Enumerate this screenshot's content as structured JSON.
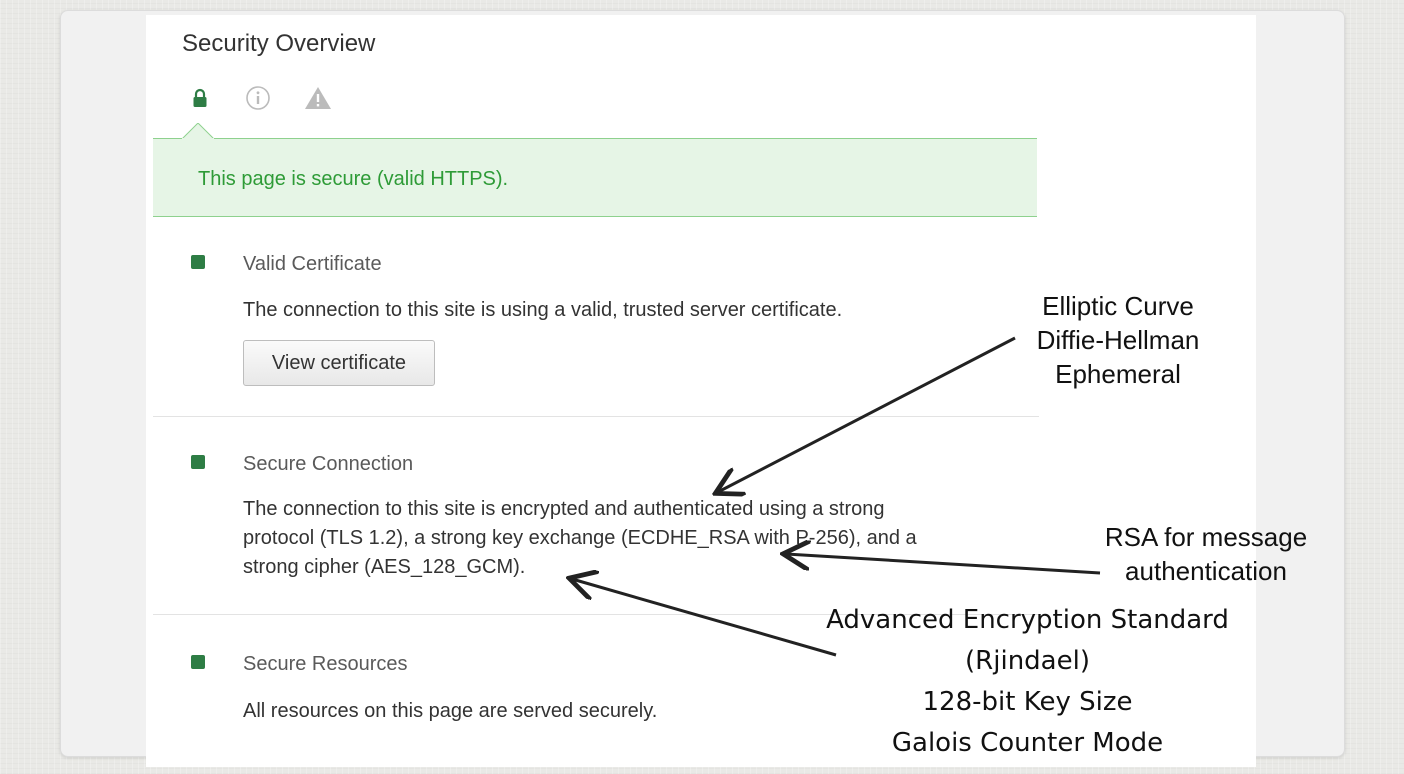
{
  "header": {
    "title": "Security Overview"
  },
  "tabs": [
    {
      "name": "lock-icon",
      "color": "#2e7d45",
      "active": true
    },
    {
      "name": "info-icon",
      "color": "#bbbbbb",
      "active": false
    },
    {
      "name": "warning-icon",
      "color": "#bbbbbb",
      "active": false
    }
  ],
  "banner": {
    "text": "This page is secure (valid HTTPS).",
    "color": "#2e9b37"
  },
  "sections": [
    {
      "title": "Valid Certificate",
      "description": "The connection to this site is using a valid, trusted server certificate.",
      "button_label": "View certificate"
    },
    {
      "title": "Secure Connection",
      "description_lines": [
        "The connection to this site is encrypted and authenticated using a strong",
        "protocol (TLS 1.2), a strong key exchange (ECDHE_RSA with P-256), and a",
        "strong cipher (AES_128_GCM)."
      ]
    },
    {
      "title": "Secure Resources",
      "description": "All resources on this page are served securely."
    }
  ],
  "annotations": {
    "ecdhe": [
      "Elliptic Curve",
      "Diffie-Hellman",
      "Ephemeral"
    ],
    "rsa": [
      "RSA for message",
      "authentication"
    ],
    "aes": [
      "Advanced Encryption Standard",
      "(Rjindael)",
      "128-bit Key Size",
      "Galois Counter Mode"
    ]
  },
  "colors": {
    "secure_green": "#2e7d45",
    "banner_bg": "#e6f5e6"
  }
}
